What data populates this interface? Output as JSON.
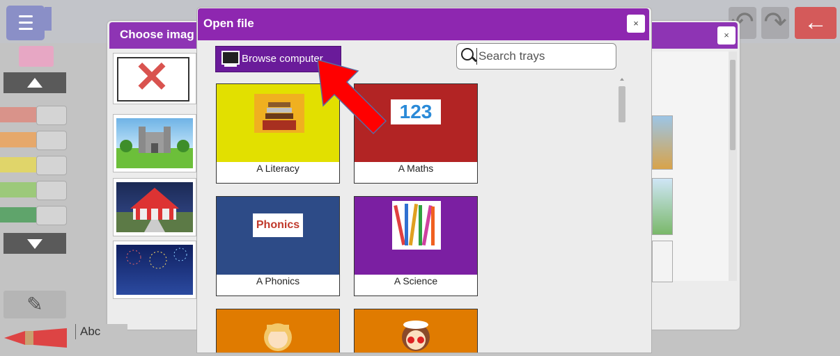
{
  "toolbar": {
    "menu": "menu-icon",
    "undo": "↶",
    "redo": "↷",
    "back": "←"
  },
  "tools": {
    "text_label": "Abc"
  },
  "choose_image": {
    "title": "Choose imag",
    "close": "×"
  },
  "open_file": {
    "title": "Open file",
    "close": "×",
    "browse_label": "Browse computer",
    "search_placeholder": "Search trays",
    "trays": [
      {
        "label": "A Literacy",
        "color": "#e2e000"
      },
      {
        "label": "A Maths",
        "color": "#b22424"
      },
      {
        "label": "A Phonics",
        "color": "#2d4b87"
      },
      {
        "label": "A Science",
        "color": "#7b1fa2"
      },
      {
        "label": "",
        "color": "#e07b00"
      },
      {
        "label": "",
        "color": "#e07b00"
      }
    ],
    "maths_icon_text": "123",
    "phonics_icon_text": "Phonics"
  },
  "colors": {
    "dialog_header": "#8e27b0",
    "browse_button": "#6a1b9a",
    "annotation_arrow": "#ff0000"
  }
}
